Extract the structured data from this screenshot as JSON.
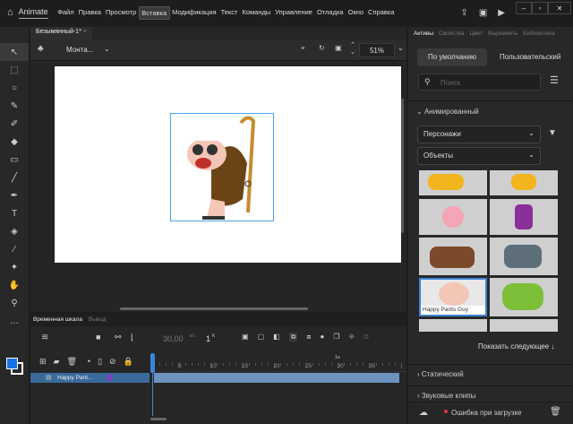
{
  "app": {
    "title": "Animate"
  },
  "menu": [
    "Файл",
    "Правка",
    "Просмотр",
    "Вставка",
    "Модификация",
    "Текст",
    "Команды",
    "Управление",
    "Отладка",
    "Окно",
    "Справка"
  ],
  "menu_active": "Вставка",
  "window_controls": {
    "minimize": "–",
    "maximize": "▫",
    "close": "✕"
  },
  "document": {
    "tab": "Безымянный-1*",
    "tab_close": "×",
    "scene": "Монта...",
    "zoom": "51%"
  },
  "timeline": {
    "tabs": [
      "Временная шкала",
      "Вывод"
    ],
    "fps": "30,00",
    "fps_unit": "к/с",
    "frame": "1",
    "frame_unit": "К",
    "ruler": [
      "5",
      "10",
      "15",
      "20",
      "25",
      "30",
      "35"
    ],
    "second_marker": "1s",
    "layer": {
      "name": "Happy Pant...",
      "color": "#9b30d0"
    }
  },
  "right_panel": {
    "tabs": [
      "Активы",
      "Свойства",
      "Цвет",
      "Выровнять",
      "Библиотека"
    ],
    "mode_default": "По умолчанию",
    "mode_custom": "Пользовательский",
    "search_placeholder": "Поиск",
    "section_animated": "Анимированный",
    "filter1": "Персонажи",
    "filter2": "Объекты",
    "selected_asset": "Happy Pants Guy",
    "show_more": "Показать следующее",
    "section_static": "Статический",
    "section_sound": "Звуковые клипы",
    "status": "Ошибка при загрузке",
    "status_color": "#e0334a"
  },
  "colors": {
    "accent": "#3d84d6",
    "stroke": "#ffffff",
    "fill": "#1473e6"
  }
}
